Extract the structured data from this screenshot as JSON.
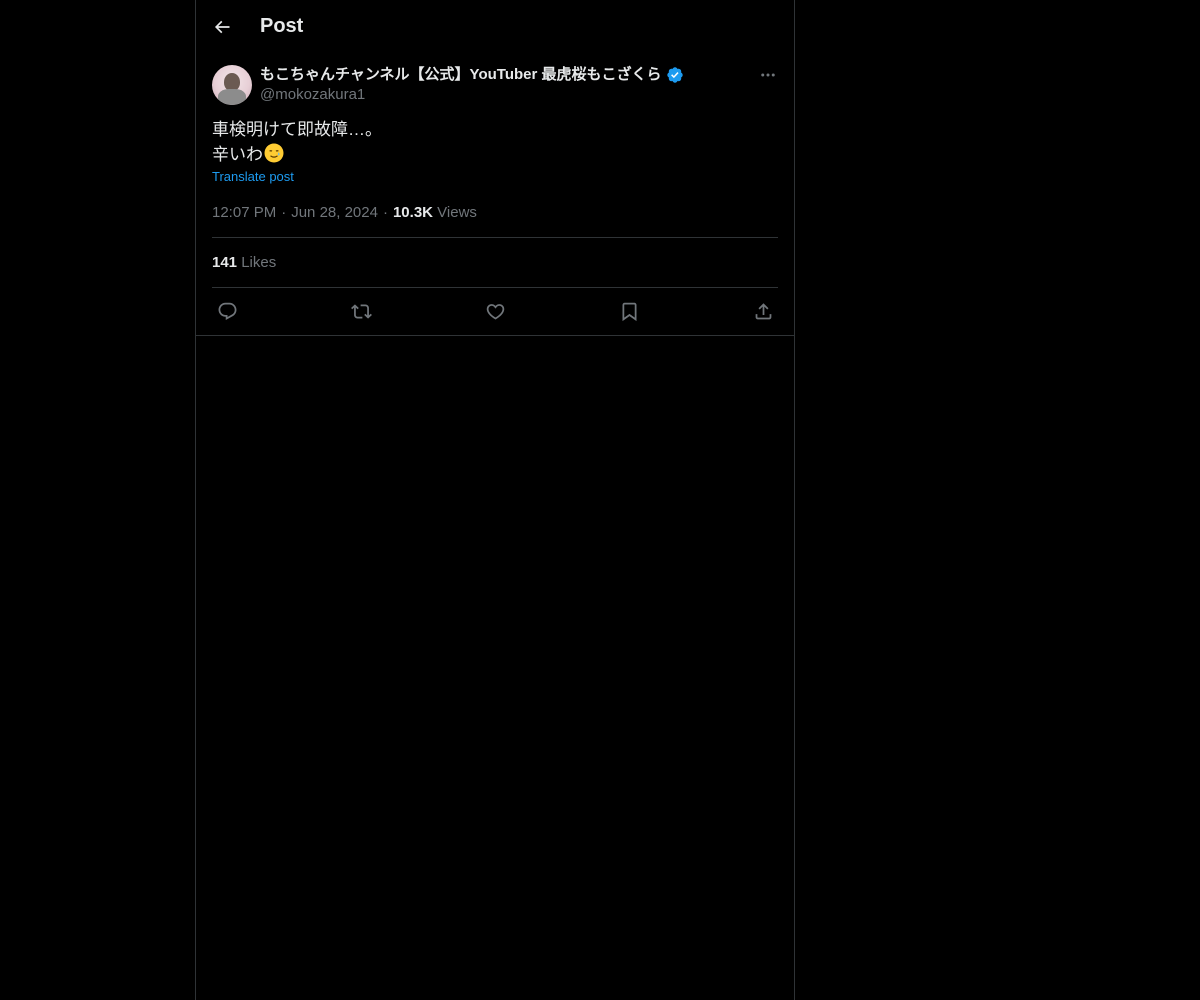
{
  "header": {
    "title": "Post"
  },
  "post": {
    "author": {
      "display_name": "もこちゃんチャンネル【公式】YouTuber 最虎桜もこざくら",
      "handle": "@mokozakura1",
      "verified": true
    },
    "text_line1": "車検明けて即故障…。",
    "text_line2": "辛いわ",
    "emoji": "smiling-face-with-tear",
    "translate_label": "Translate post",
    "time": "12:07 PM",
    "date": "Jun 28, 2024",
    "views_count": "10.3K",
    "views_label": "Views",
    "likes_count": "141",
    "likes_label": "Likes"
  },
  "colors": {
    "background": "#000000",
    "text": "#e7e9ea",
    "secondary": "#71767b",
    "link": "#1d9bf0",
    "border": "#2f3336"
  },
  "icons": {
    "back": "arrow-left-icon",
    "more": "more-icon",
    "verified": "verified-badge-icon",
    "reply": "reply-icon",
    "repost": "repost-icon",
    "like": "heart-icon",
    "bookmark": "bookmark-icon",
    "share": "share-icon"
  }
}
